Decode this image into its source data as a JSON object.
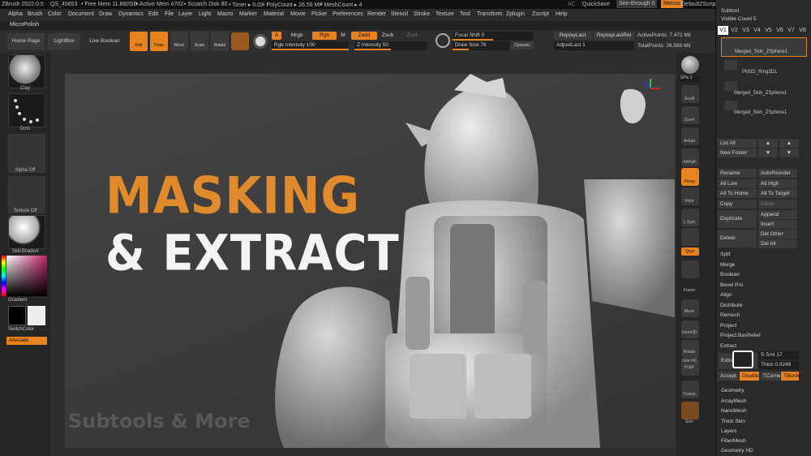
{
  "titlebar": {
    "app": "ZBrush 2022.0.5",
    "file": "QS_45853",
    "freemem": "• Free Mem 11.882GB",
    "activemem": "• Active Mem 4702",
    "scratch": "• Scratch Disk 80",
    "timer": "• Timer ▸ 0.02",
    "polycount": "• PolyCount ▸ 26.59 MP",
    "meshcount": "• MeshCount ▸ 4",
    "ac": "AC",
    "quicksave": "QuickSave",
    "seethrough": "See-through 0",
    "menus": "Menus",
    "zscript": "DefaultZScript"
  },
  "menus": [
    "Alpha",
    "Brush",
    "Color",
    "Document",
    "Draw",
    "Dynamics",
    "Edit",
    "File",
    "Layer",
    "Light",
    "Macro",
    "Marker",
    "Material",
    "Movie",
    "Picker",
    "Preferences",
    "Render",
    "Stencil",
    "Stroke",
    "Texture",
    "Tool",
    "Transform",
    "Zplugin",
    "Zscript",
    "Help"
  ],
  "brush_name": "MicroPolish",
  "toolbar": {
    "home": "Home Page",
    "lightbox": "LightBox",
    "liveboolean": "Live Boolean",
    "edit": "Edit",
    "draw": "Draw",
    "move": "Move",
    "scale": "Scale",
    "rotate": "Rotate",
    "a": "A",
    "mrgb": "Mrgb",
    "rgb": "Rgb",
    "m": "M",
    "zadd": "Zadd",
    "zsub": "Zsub",
    "zcut": "Zcut",
    "rgb_intensity": "Rgb Intensity 100",
    "z_intensity": "Z Intensity 50",
    "focal": "Focal Shift 0",
    "drawsize": "Draw Size 76",
    "dynamic": "Dynamic",
    "replaylast": "ReplayLast",
    "replaylastrel": "ReplayLastRel",
    "adjustlast": "AdjustLast 1",
    "activepoints": "ActivePoints: 7.472 Mil",
    "totalpoints": "TotalPoints: 26.569 Mil"
  },
  "leftshelf": {
    "clay": "Clay",
    "dots": "Dots",
    "alpha": "Alpha Off",
    "texture": "Texture Off",
    "material": "SkinShade4",
    "gradient": "Gradient",
    "switch": "SwitchColor",
    "alternate": "Alternate"
  },
  "rightshelf": {
    "bpr": "BPR",
    "spix": "SPix 3",
    "scroll": "Scroll",
    "zoom": "Zoom",
    "actual": "Actual",
    "aahalf": "AAHalf",
    "persp": "Persp",
    "floor": "Floor",
    "lsym": "L.Sym",
    "xyz": "Qxyz",
    "frame": "Frame",
    "move": "Move",
    "zoom3d": "Zoom3D",
    "rotate": "Rotate",
    "linefill": "Line Fill",
    "polyf": "PolyF",
    "transp": "Transp",
    "solo": "Solo"
  },
  "overlay": {
    "line1": "MASKING",
    "line2": "& EXTRACT",
    "line3": "Subtools & More"
  },
  "subtool": {
    "header": "Subtool",
    "visible": "Visible Count 5",
    "versions": [
      "V1",
      "V2",
      "V3",
      "V4",
      "V5",
      "V6",
      "V7",
      "V8"
    ],
    "items": [
      "Merged_Skin_ZSphere1",
      "PM3D_Ring3D1",
      "Merged_Skin_ZSphere1",
      "Merged_Skin_ZSphere1"
    ],
    "listall": "List All",
    "newfolder": "New Folder",
    "rename": "Rename",
    "autoreorder": "AutoReorder",
    "alllow": "All Low",
    "allhigh": "All High",
    "alltohome": "All To Home",
    "alltotarget": "All To Target",
    "copy": "Copy",
    "paste": "Paste",
    "duplicate": "Duplicate",
    "append": "Append",
    "insert": "Insert",
    "delete": "Delete",
    "delother": "Del Other",
    "delall": "Del All",
    "split": "Split",
    "merge": "Merge",
    "boolean": "Boolean",
    "bevelpro": "Bevel Pro",
    "align": "Align",
    "distribute": "Distribute",
    "remesh": "Remesh",
    "project": "Project",
    "projectbasrelief": "Project BasRelief",
    "extract": "Extract",
    "extract_btn": "Extra",
    "ssmt": "S Smt 17",
    "thick": "Thick 0.0249",
    "accept": "Accept",
    "double": "Double",
    "tcorne": "TCorne",
    "tborder": "TBorder",
    "geometry": "Geometry",
    "arraymesh": "ArrayMesh",
    "nanomesh": "NanoMesh",
    "thickskin": "Thick Skin",
    "layers": "Layers",
    "fibermesh": "FiberMesh",
    "geometryhd": "Geometry HD"
  },
  "colors": {
    "accent": "#e8821e",
    "title_orange": "#e08a2c"
  }
}
